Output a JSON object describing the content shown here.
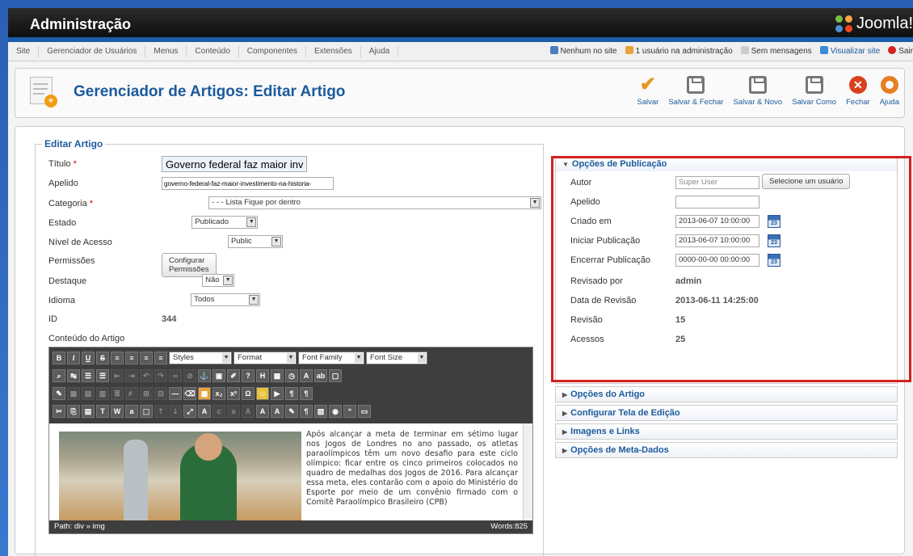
{
  "header": {
    "title": "Administração",
    "brand": "Joomla!"
  },
  "menu": [
    "Site",
    "Gerenciador de Usuários",
    "Menus",
    "Conteúdo",
    "Componentes",
    "Extensões",
    "Ajuda"
  ],
  "status": {
    "no_site": "Nenhum no site",
    "admins": "1 usuário na administração",
    "messages": "Sem mensagens",
    "view_site": "Visualizar site",
    "logout": "Sair"
  },
  "toolbar": {
    "page_title": "Gerenciador de Artigos: Editar Artigo",
    "save": "Salvar",
    "save_close": "Salvar & Fechar",
    "save_new": "Salvar & Novo",
    "save_copy": "Salvar Como",
    "close": "Fechar",
    "help": "Ajuda"
  },
  "form": {
    "legend": "Editar Artigo",
    "title_label": "Título",
    "title_value": "Governo federal faz maior investim",
    "alias_label": "Apelido",
    "alias_value": "governo-federal-faz-maior-investimento-na-historia-",
    "category_label": "Categoria",
    "category_value": "- - - Lista Fique por dentro",
    "state_label": "Estado",
    "state_value": "Publicado",
    "access_label": "Nível de Acesso",
    "access_value": "Public",
    "permissions_label": "Permissões",
    "permissions_button": "Configurar Permissões",
    "featured_label": "Destaque",
    "featured_value": "Não",
    "language_label": "Idioma",
    "language_value": "Todos",
    "id_label": "ID",
    "id_value": "344",
    "content_label": "Conteúdo do Artigo",
    "required_mark": "*"
  },
  "editor": {
    "styles": "Styles",
    "format": "Format",
    "font_family": "Font Family",
    "font_size": "Font Size",
    "article_text": "Após alcançar a meta de terminar em sétimo lugar nos Jogos de Londres no ano passado, os atletas paraolímpicos têm um novo desafio para este ciclo olímpico: ficar entre os cinco primeiros colocados no quadro de medalhas dos Jogos de 2016. Para alcançar essa meta, eles contarão com o apoio do Ministério do Esporte por meio de um convênio firmado com o Comitê Paraolímpico Brasileiro (CPB)",
    "path": "Path: div » img",
    "words": "Words:825"
  },
  "publishing": {
    "title": "Opções de Publicação",
    "author_label": "Autor",
    "author_value": "Super User",
    "select_user": "Selecione um usuário",
    "alias_label": "Apelido",
    "created_label": "Criado em",
    "created_value": "2013-06-07 10:00:00",
    "start_label": "Iniciar Publicação",
    "start_value": "2013-06-07 10:00:00",
    "end_label": "Encerrar Publicação",
    "end_value": "0000-00-00 00:00:00",
    "revised_by_label": "Revisado por",
    "revised_by_value": "admin",
    "revision_date_label": "Data de Revisão",
    "revision_date_value": "2013-06-11 14:25:00",
    "revision_label": "Revisão",
    "revision_value": "15",
    "hits_label": "Acessos",
    "hits_value": "25",
    "cal_label": "23"
  },
  "panels": [
    "Opções do Artigo",
    "Configurar Tela de Edição",
    "Imagens e Links",
    "Opções de Meta-Dados"
  ],
  "icons": [
    "joomla-logo-icon",
    "article-add-icon",
    "check-icon",
    "save-icon",
    "close-icon",
    "help-icon",
    "calendar-icon"
  ]
}
